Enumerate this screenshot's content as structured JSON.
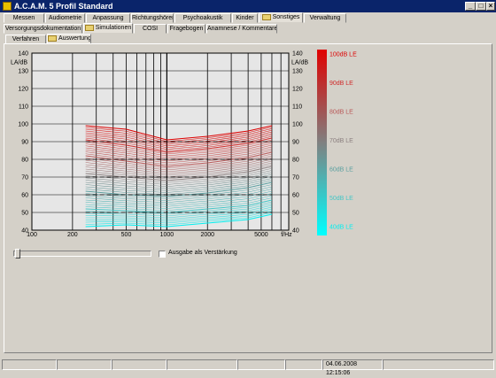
{
  "window": {
    "title": "A.C.A.M. 5 Profil Standard",
    "min_label": "_",
    "max_label": "□",
    "close_label": "×"
  },
  "tabs_row1": [
    "Messen",
    "Audiometrie",
    "Anpassung",
    "Richtungshören",
    "Psychoakustik",
    "Kinder",
    "Sonstiges",
    "Verwaltung"
  ],
  "tabs_row2": [
    "Versorgungsdokumentation",
    "Simulationen",
    "COSI",
    "Fragebogen",
    "Anamnese / Kommentare"
  ],
  "tabs_row3": [
    "Verfahren",
    "Auswertung"
  ],
  "active": {
    "row1": "Sonstiges",
    "row2": "Simulationen",
    "row3": "Auswertung"
  },
  "controls": {
    "ausgabe_label": "Ausgabe als Verstärkung",
    "ausgabe_checked": false,
    "slider_position": 0.02
  },
  "status": {
    "datetime": "04.06.2008 12:15:06"
  },
  "chart_data": {
    "type": "line",
    "y_unit_label": "LA/dB",
    "x_unit_label": "f/Hz",
    "ylim": [
      40,
      140
    ],
    "y_ticks": [
      40,
      50,
      60,
      70,
      80,
      90,
      100,
      110,
      120,
      130,
      140
    ],
    "xlim": [
      100,
      8000
    ],
    "x_scale": "log",
    "x_tick_labels": [
      {
        "f": 100,
        "label": "100"
      },
      {
        "f": 200,
        "label": "200"
      },
      {
        "f": 500,
        "label": "500"
      },
      {
        "f": 1000,
        "label": "1000"
      },
      {
        "f": 2000,
        "label": "2000"
      },
      {
        "f": 5000,
        "label": "5000"
      }
    ],
    "grid": true,
    "series": [
      {
        "name": "100dB LE",
        "x": [
          250,
          500,
          1000,
          2000,
          4000,
          6000
        ],
        "y": [
          99,
          97,
          91,
          93,
          96,
          99
        ],
        "color": "#dd0000"
      },
      {
        "name": "90dB LE",
        "x": [
          250,
          500,
          1000,
          2000,
          4000,
          6000
        ],
        "y": [
          91,
          88,
          84,
          86,
          89,
          92
        ],
        "color": "#d02a2a"
      },
      {
        "name": "80dB LE",
        "x": [
          250,
          500,
          1000,
          2000,
          4000,
          6000
        ],
        "y": [
          82,
          79,
          76,
          78,
          81,
          84
        ],
        "color": "#b85656"
      },
      {
        "name": "70dB LE",
        "x": [
          250,
          500,
          1000,
          2000,
          4000,
          6000
        ],
        "y": [
          72,
          70,
          68,
          70,
          73,
          76
        ],
        "color": "#8c8080"
      },
      {
        "name": "60dB LE",
        "x": [
          250,
          500,
          1000,
          2000,
          4000,
          6000
        ],
        "y": [
          62,
          60,
          59,
          61,
          64,
          67
        ],
        "color": "#5aa0a0"
      },
      {
        "name": "50dB LE",
        "x": [
          250,
          500,
          1000,
          2000,
          4000,
          6000
        ],
        "y": [
          52,
          51,
          50,
          52,
          54,
          57
        ],
        "color": "#44c6c6"
      },
      {
        "name": "40dB LE",
        "x": [
          250,
          500,
          1000,
          2000,
          4000,
          6000
        ],
        "y": [
          42,
          43,
          42,
          44,
          46,
          49
        ],
        "color": "#00f0f0"
      }
    ],
    "legend_labels": [
      "100dB LE",
      "90dB LE",
      "80dB LE",
      "70dB LE",
      "60dB LE",
      "50dB LE",
      "40dB LE"
    ],
    "legend_placement": "right",
    "colors": {
      "loud": "#e00000",
      "mid": "#808080",
      "soft": "#00ffff"
    }
  }
}
